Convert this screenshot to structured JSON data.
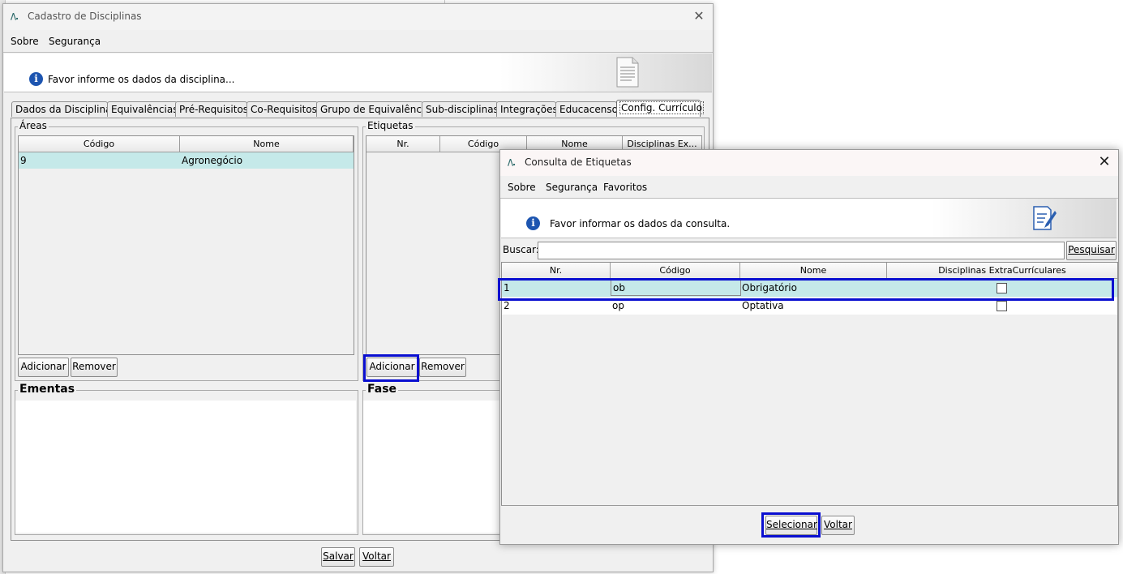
{
  "main_window": {
    "title": "Cadastro de Disciplinas",
    "menu": [
      "Sobre",
      "Segurança"
    ],
    "info_text": "Favor informe os dados da disciplina...",
    "tabs": [
      "Dados da Disciplina",
      "Equivalências",
      "Pré-Requisitos",
      "Co-Requisitos",
      "Grupo de Equivalência",
      "Sub-disciplinas",
      "Integrações",
      "Educacenso",
      "Config. Currículo"
    ],
    "active_tab": "Config. Currículo",
    "areas": {
      "label": "Áreas",
      "columns": [
        "Código",
        "Nome"
      ],
      "rows": [
        {
          "codigo": "9",
          "nome": "Agronegócio"
        }
      ],
      "add_button": "Adicionar",
      "remove_button": "Remover"
    },
    "etiquetas": {
      "label": "Etiquetas",
      "columns": [
        "Nr.",
        "Código",
        "Nome",
        "Disciplinas Ex..."
      ],
      "add_button": "Adicionar",
      "remove_button": "Remover"
    },
    "ementas_label": "Ementas",
    "fase_label": "Fase",
    "save_button": "Salvar",
    "back_button": "Voltar"
  },
  "dialog": {
    "title": "Consulta de Etiquetas",
    "menu": [
      "Sobre",
      "Segurança",
      "Favoritos"
    ],
    "info_text": "Favor informar os dados da consulta.",
    "search_label": "Buscar:",
    "search_value": "",
    "search_button": "Pesquisar",
    "columns": [
      "Nr.",
      "Código",
      "Nome",
      "Disciplinas ExtraCurrículares"
    ],
    "rows": [
      {
        "nr": "1",
        "codigo": "ob",
        "nome": "Obrigatório",
        "extra": false,
        "selected": true
      },
      {
        "nr": "2",
        "codigo": "op",
        "nome": "Optativa",
        "extra": false,
        "selected": false
      }
    ],
    "select_button": "Selecionar",
    "back_button": "Voltar"
  },
  "colors": {
    "selection": "#c5e9e9",
    "highlight": "#0a0fd0",
    "info_icon": "#1d55b0"
  }
}
